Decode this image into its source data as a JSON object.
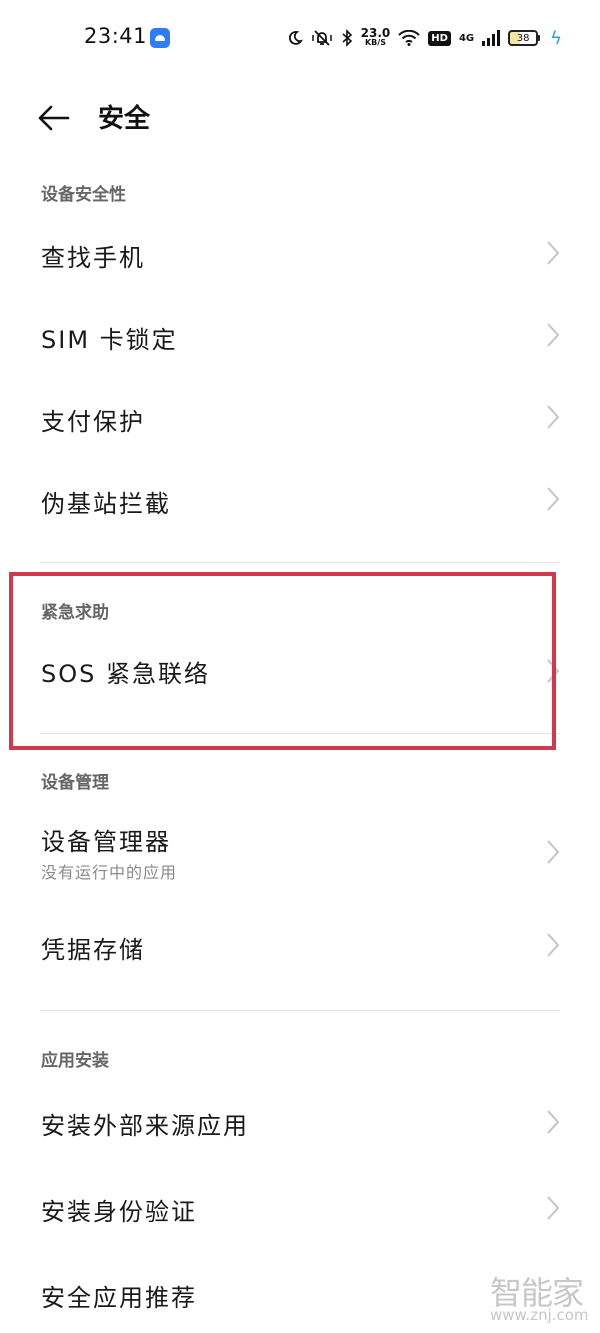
{
  "status_bar": {
    "time": "23:41",
    "net_speed_value": "23.0",
    "net_speed_unit": "KB/S",
    "hd": "HD",
    "network_type": "4G",
    "battery_level": "38",
    "icons": [
      "android-app-icon",
      "moon-icon",
      "mute-bell-icon",
      "bluetooth-icon",
      "wifi-icon",
      "signal-icon",
      "battery-icon",
      "charging-icon"
    ]
  },
  "header": {
    "title": "安全"
  },
  "sections": {
    "device_security": {
      "label": "设备安全性",
      "items": [
        "查找手机",
        "SIM 卡锁定",
        "支付保护",
        "伪基站拦截"
      ]
    },
    "emergency": {
      "label": "紧急求助",
      "items": [
        "SOS 紧急联络"
      ]
    },
    "device_management": {
      "label": "设备管理",
      "items": [
        {
          "title": "设备管理器",
          "subtitle": "没有运行中的应用"
        },
        {
          "title": "凭据存储"
        }
      ]
    },
    "app_install": {
      "label": "应用安装",
      "items": [
        "安装外部来源应用",
        "安装身份验证",
        "安全应用推荐"
      ]
    }
  },
  "watermark": {
    "main": "智能家",
    "url": "www.znj.com"
  },
  "colors": {
    "highlight": "#d13a4c",
    "section_label": "#666666",
    "chevron": "#c4c4c4"
  }
}
